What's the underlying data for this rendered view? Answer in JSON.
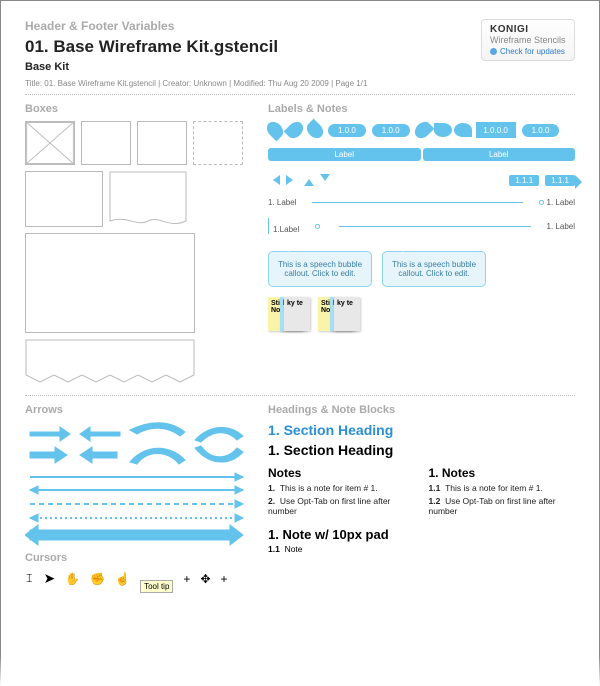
{
  "header": {
    "header_var_label": "Header & Footer Variables",
    "title": "01. Base Wireframe Kit.gstencil",
    "subtitle": "Base Kit",
    "meta": "Title: 01. Base Wireframe Kit.gstencil  |  Creator: Unknown  |  Modified: Thu Aug 20 2009  |  Page 1/1"
  },
  "badge": {
    "brand": "KONIGI",
    "line": "Wireframe Stencils",
    "check": "Check for updates"
  },
  "sections": {
    "boxes": "Boxes",
    "labels": "Labels & Notes",
    "arrows": "Arrows",
    "cursors": "Cursors",
    "headings": "Headings & Note Blocks"
  },
  "labels": {
    "versions": [
      "1.0.0",
      "1.0.0",
      "1.0.0",
      "1.0.0.0",
      "1.0.0"
    ],
    "label_word": "Label",
    "marker_a": "1.1.1",
    "marker_b": "1.1.1",
    "note_prefix": "1.",
    "note_word": "Label"
  },
  "callout": {
    "speech": "This is a speech bubble callout. Click to edit.",
    "sticky": "Sticky Notes",
    "sticky_short": "ky te"
  },
  "headings_block": {
    "blue": "1. Section Heading",
    "black": "1. Section Heading",
    "notes_a_title": "Notes",
    "notes_b_title": "1.   Notes",
    "note1": "This is a note for item # 1.",
    "note2": "Use Opt-Tab on first line after number",
    "idx_a1": "1.",
    "idx_a2": "2.",
    "idx_b1": "1.1",
    "idx_b2": "1.2",
    "padhead": "1.   Note w/ 10px pad",
    "padnote_idx": "1.1",
    "padnote": "Note"
  },
  "cursors": {
    "tooltip": "Tool tip"
  },
  "colors": {
    "accent": "#63c3ec",
    "muted": "#aaaaaa"
  }
}
